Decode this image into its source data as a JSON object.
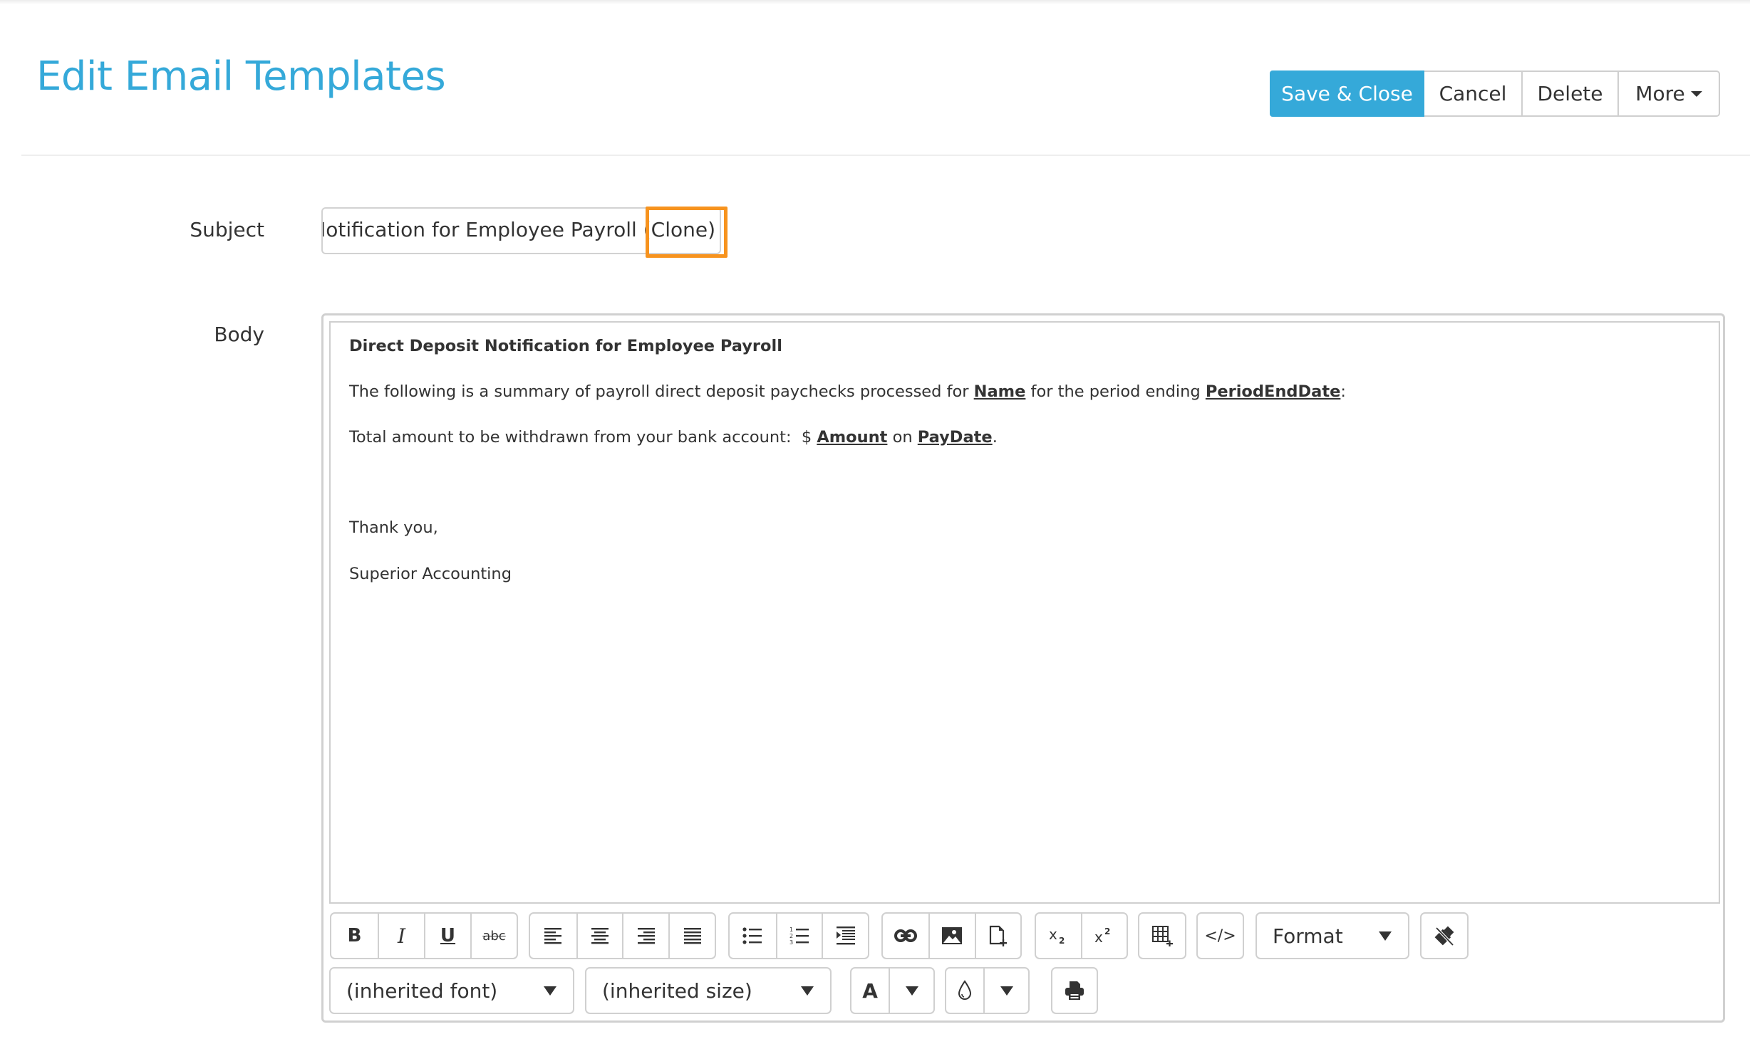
{
  "header": {
    "title": "Edit Email Templates",
    "buttons": {
      "save_close": "Save & Close",
      "cancel": "Cancel",
      "delete": "Delete",
      "more": "More"
    }
  },
  "form": {
    "subject_label": "Subject",
    "subject_value": "Direct Deposit Notification for Employee Payroll (Clone)",
    "subject_visible": "sit Notification for Employee Payroll (Clone)",
    "body_label": "Body",
    "highlight_color": "#f7931e"
  },
  "body": {
    "heading": "Direct Deposit Notification for Employee Payroll",
    "line1_pre": "The following is a summary of payroll direct deposit paychecks processed for ",
    "line1_field1": "Name",
    "line1_mid": " for the period ending ",
    "line1_field2": "PeriodEndDate",
    "line1_post": ":",
    "line2_pre": "Total amount to be withdrawn from your bank account:  $ ",
    "line2_field1": "Amount",
    "line2_mid": " on ",
    "line2_field2": "PayDate",
    "line2_post": ".",
    "closing": "Thank you,",
    "signature": "Superior Accounting"
  },
  "toolbar": {
    "row1": {
      "text_style": [
        "bold",
        "italic",
        "underline",
        "strikethrough"
      ],
      "bold_glyph": "B",
      "italic_glyph": "I",
      "underline_glyph": "U",
      "strike_glyph": "abc",
      "align": [
        "align-left",
        "align-center",
        "align-right",
        "align-justify"
      ],
      "lists": [
        "unordered-list",
        "ordered-list",
        "indent"
      ],
      "insert": [
        "link",
        "image",
        "file"
      ],
      "script": [
        "subscript",
        "superscript"
      ],
      "table": "insert-table",
      "code": "source-code",
      "code_glyph": "</>",
      "format_label": "Format",
      "clear": "clear-formatting"
    },
    "row2": {
      "font_select": "(inherited font)",
      "size_select": "(inherited size)",
      "font_color_glyph": "A",
      "background_color": "fill-color",
      "print": "print"
    }
  },
  "colors": {
    "accent": "#35a9d9",
    "text": "#333333",
    "border": "#d0d0d0"
  }
}
